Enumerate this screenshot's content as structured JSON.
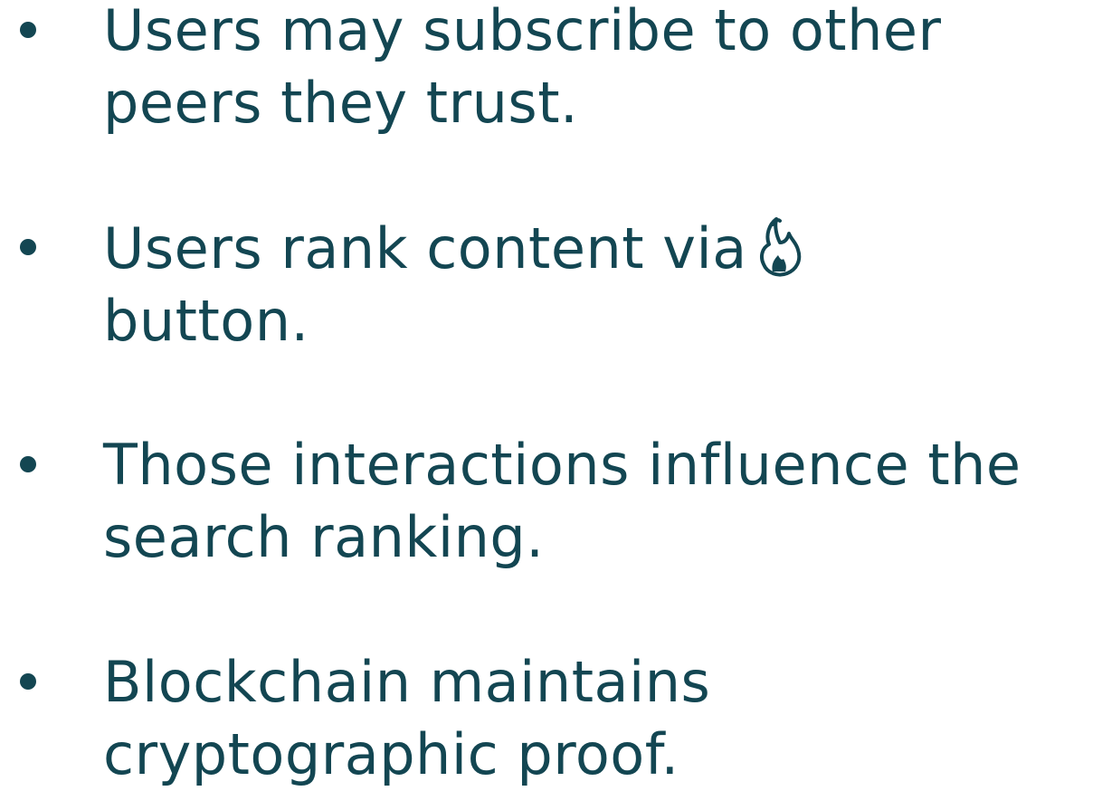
{
  "bullets": [
    {
      "line1": "Users may subscribe to other",
      "line2": "peers they trust."
    },
    {
      "line1": "Users rank content via",
      "icon": "fire-icon",
      "line2": "button."
    },
    {
      "line1": "Those interactions influence the",
      "line2": "search ranking."
    },
    {
      "line1": "Blockchain maintains",
      "line2": "cryptographic proof."
    }
  ],
  "colors": {
    "text": "#134652",
    "background": "#ffffff"
  }
}
